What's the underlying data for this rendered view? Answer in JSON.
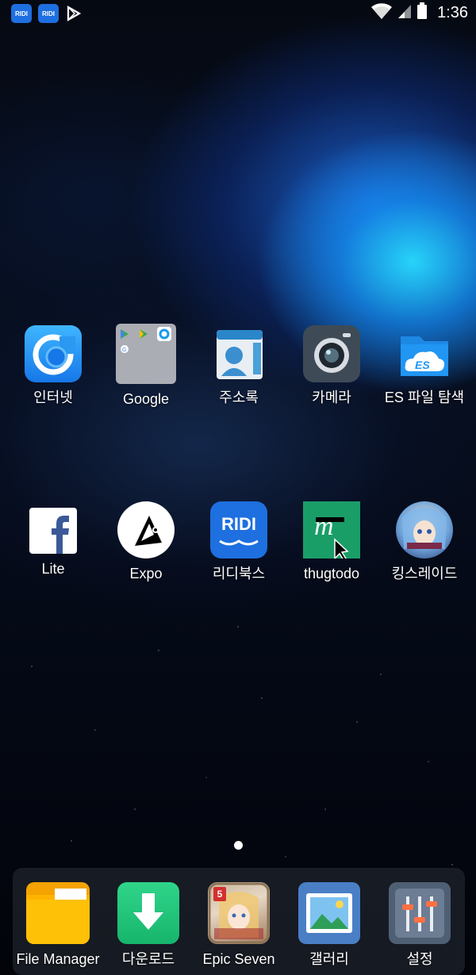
{
  "status_bar": {
    "notification_icons": [
      "RIDI",
      "RIDI",
      "play-store"
    ],
    "time": "1:36"
  },
  "home_rows": [
    [
      {
        "label": "인터넷",
        "icon": "internet-icon"
      },
      {
        "label": "Google",
        "icon": "google-folder-icon"
      },
      {
        "label": "주소록",
        "icon": "contacts-icon"
      },
      {
        "label": "카메라",
        "icon": "camera-icon"
      },
      {
        "label": "ES 파일 탐색",
        "icon": "es-file-explorer-icon"
      }
    ],
    [
      {
        "label": "Lite",
        "icon": "facebook-lite-icon"
      },
      {
        "label": "Expo",
        "icon": "expo-icon"
      },
      {
        "label": "리디북스",
        "icon": "ridibooks-icon",
        "icon_text": "RIDI"
      },
      {
        "label": "thugtodo",
        "icon": "thugtodo-icon"
      },
      {
        "label": "킹스레이드",
        "icon": "kings-raid-icon"
      }
    ]
  ],
  "dock": [
    {
      "label": "File Manager",
      "icon": "file-manager-icon"
    },
    {
      "label": "다운로드",
      "icon": "download-icon"
    },
    {
      "label": "Epic Seven",
      "icon": "epic-seven-icon",
      "badge": "5"
    },
    {
      "label": "갤러리",
      "icon": "gallery-icon"
    },
    {
      "label": "설정",
      "icon": "settings-icon"
    }
  ],
  "page_indicator": {
    "current": 1,
    "total": 1
  }
}
